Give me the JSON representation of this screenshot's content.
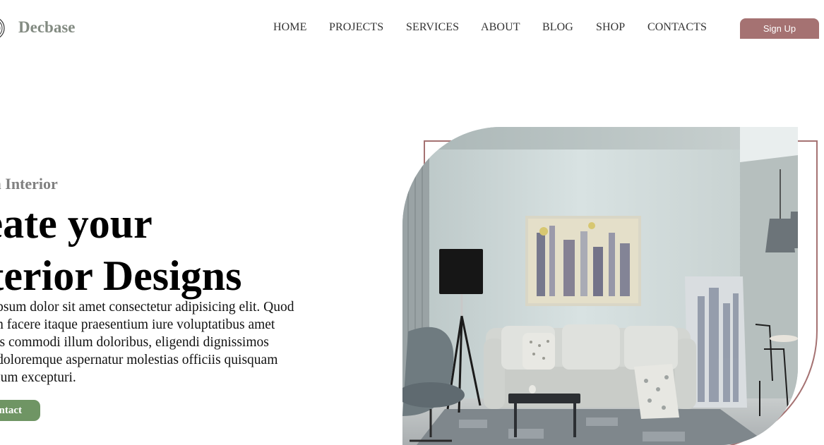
{
  "brand": {
    "name": "Decbase"
  },
  "nav": {
    "items": [
      {
        "label": "HOME"
      },
      {
        "label": "PROJECTS"
      },
      {
        "label": "SERVICES"
      },
      {
        "label": "ABOUT"
      },
      {
        "label": "BLOG"
      },
      {
        "label": "SHOP"
      },
      {
        "label": "CONTACTS"
      }
    ],
    "signup_label": "Sign Up"
  },
  "hero": {
    "eyebrow": "ern Interior",
    "title_lines": [
      "reate your",
      "nterior Designs"
    ],
    "body_lines": [
      ", ipsum dolor sit amet consectetur adipisicing elit. Quod",
      "um facere itaque praesentium iure voluptatibus amet",
      "nus commodi illum doloribus, eligendi dignissimos",
      "l, doloremque aspernatur molestias officiis quisquam",
      "ntium excepturi."
    ],
    "contact_label": "ntact"
  },
  "colors": {
    "accent_rose": "#a57272",
    "accent_green": "#6f9564",
    "logo_grey": "#838b82"
  }
}
